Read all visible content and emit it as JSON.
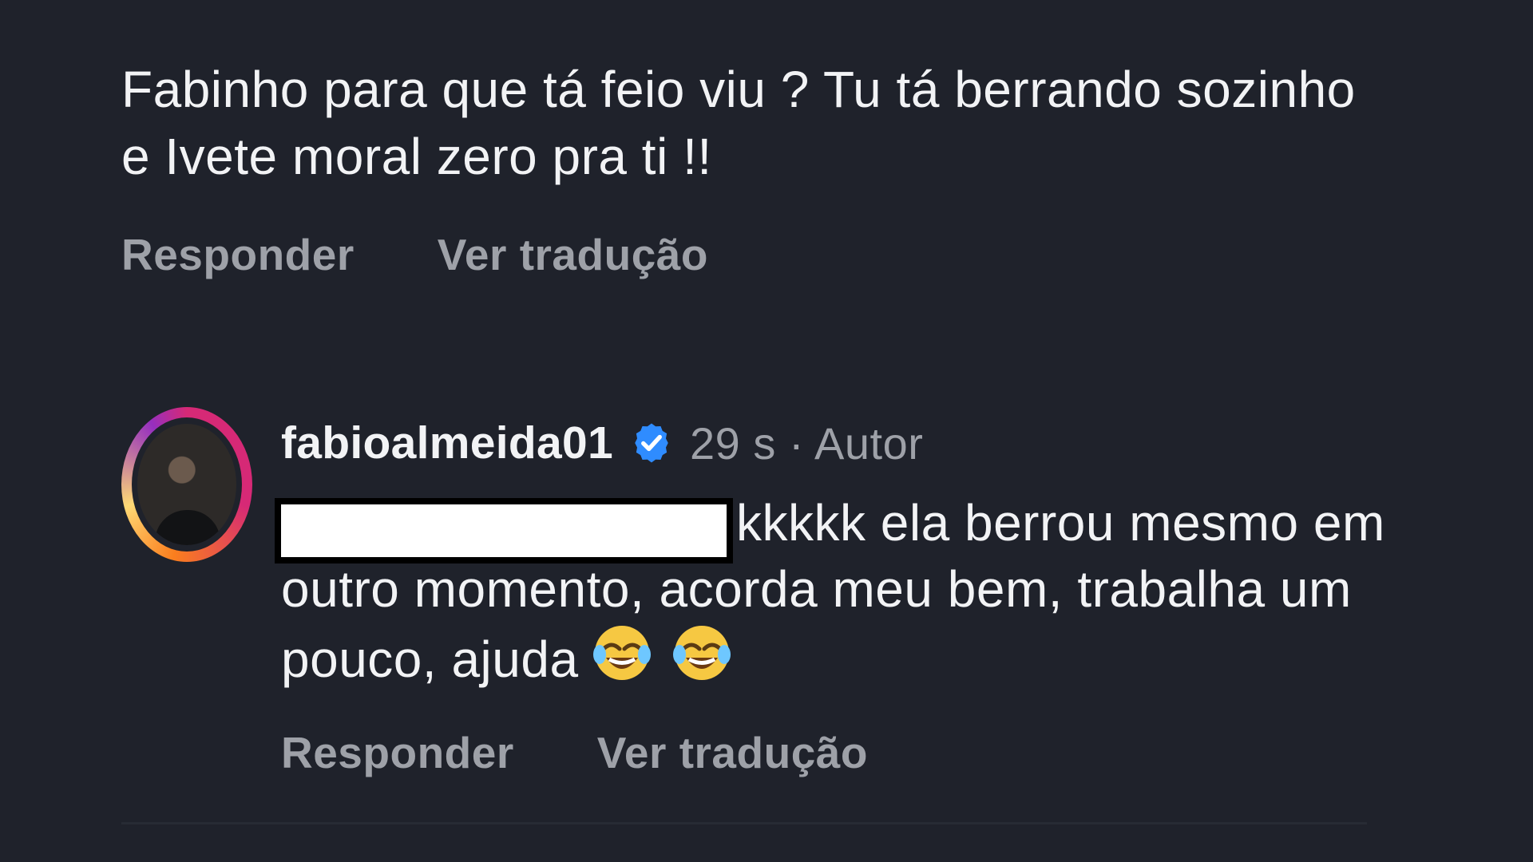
{
  "top_comment": {
    "text": "Fabinho para que tá feio viu ? Tu tá berrando sozinho e Ivete moral zero pra ti !!",
    "actions": [
      "Responder",
      "Ver tradução"
    ]
  },
  "reply": {
    "username": "fabioalmeida01",
    "verified_icon": "verified-badge-icon",
    "time_author": "29 s · Autor",
    "text_before_emoji": "kkkkk ela berrou mesmo em outro momento, acorda meu bem, trabalha um pouco, ajuda ",
    "emoji_name": "face-with-tears-of-joy",
    "actions": [
      "Responder",
      "Ver tradução"
    ]
  },
  "colors": {
    "background": "#1f222b",
    "text_primary": "#f2f3f5",
    "text_secondary": "#9ea1a8",
    "verified_blue": "#2f8cff"
  }
}
